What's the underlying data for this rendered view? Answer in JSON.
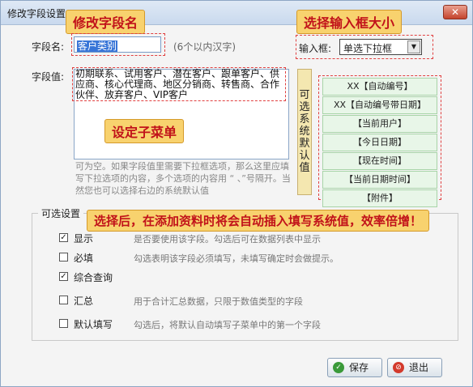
{
  "window": {
    "title": "修改字段设置",
    "close_label": "✕"
  },
  "callouts": {
    "edit_field_name": "修改字段名",
    "select_input_size": "选择输入框大小",
    "set_submenu": "设定子菜单",
    "auto_insert_tip": "选择后，在添加资料时将会自动插入填写系统值，效率倍增！"
  },
  "field_name": {
    "label": "字段名:",
    "value": "客户类别",
    "hint": "(6个以内汉字)"
  },
  "input_box": {
    "label": "输入框:",
    "selected": "单选下拉框"
  },
  "field_value": {
    "label": "字段值:",
    "content": "初期联系、试用客户、潜在客户、跟单客户、供应商、核心代理商、地区分销商、转售商、合作伙伴、放弃客户、VIP客户",
    "hint": "可为空。如果字段值里需要下拉框选项，那么这里应填写下拉选项的内容，多个选项的内容用 “ 、”号隔开。当然您也可以选择右边的系统默认值"
  },
  "system_default": {
    "label_chars": [
      "可",
      "选",
      "系",
      "统",
      "默",
      "认",
      "值"
    ],
    "items": [
      "XX【自动编号】",
      "XX【自动编号带日期】",
      "【当前用户】",
      "【今日日期】",
      "【现在时间】",
      "【当前日期时间】",
      "【附件】"
    ]
  },
  "options": {
    "legend": "可选设置",
    "items": [
      {
        "label": "显示",
        "checked": "✓",
        "desc": "是否要使用该字段。勾选后可在数据列表中显示"
      },
      {
        "label": "必填",
        "checked": "",
        "desc": "勾选表明该字段必须填写，未填写确定时会做提示。"
      },
      {
        "label": "综合查询",
        "checked": "✓",
        "desc": ""
      },
      {
        "label": "汇总",
        "checked": "",
        "desc": "用于合计汇总数据，只限于数值类型的字段"
      },
      {
        "label": "默认填写",
        "checked": "",
        "desc": "勾选后，将默认自动填写子菜单中的第一个字段"
      }
    ]
  },
  "buttons": {
    "save": "保存",
    "exit": "退出"
  },
  "colors": {
    "callout_bg": "#f8d26e",
    "callout_text": "#c1121a",
    "accent_green": "#3a9a3a",
    "accent_red": "#d33a2c"
  }
}
